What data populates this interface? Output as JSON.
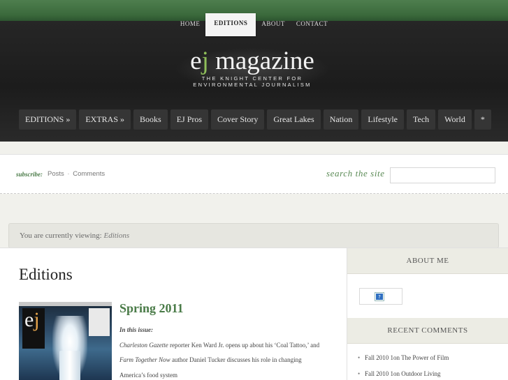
{
  "topnav": {
    "items": [
      {
        "label": "HOME",
        "active": false
      },
      {
        "label": "EDITIONS",
        "active": true
      },
      {
        "label": "ABOUT",
        "active": false
      },
      {
        "label": "CONTACT",
        "active": false
      }
    ]
  },
  "logo": {
    "title_e": "e",
    "title_j": "j",
    "title_rest": " magazine",
    "tagline_1": "THE KNIGHT CENTER FOR",
    "tagline_2": "ENVIRONMENTAL JOURNALISM"
  },
  "mainnav": {
    "items": [
      "EDITIONS »",
      "EXTRAS »",
      "Books",
      "EJ Pros",
      "Cover Story",
      "Great Lakes",
      "Nation",
      "Lifestyle",
      "Tech",
      "World",
      "*"
    ]
  },
  "subscribe": {
    "label": "subscribe:",
    "posts": "Posts",
    "separator": "·",
    "comments": "Comments"
  },
  "search": {
    "label": "search the site",
    "value": ""
  },
  "breadcrumb": {
    "prefix": "You are currently viewing:",
    "current": "Editions"
  },
  "main": {
    "page_title": "Editions",
    "post": {
      "title": "Spring 2011",
      "in_this_issue": "In this issue:",
      "line1_pub": "Charleston Gazette",
      "line1_text": " reporter Ken Ward Jr. opens up about his  ‘Coal Tattoo,’ and",
      "line2_pub": "Farm Together Now",
      "line2_text": " author Daniel Tucker discusses his role in changing",
      "line3_text": "America’s food system"
    }
  },
  "sidebar": {
    "about_heading": "ABOUT ME",
    "recent_heading": "RECENT COMMENTS",
    "recent_comments": [
      "Fall 2010 1on The Power of Film",
      "Fall 2010 1on Outdoor Living"
    ]
  },
  "colors": {
    "accent_green": "#4a7b48",
    "header_dark": "#1c1c1c",
    "top_band": "#3b6a3c"
  }
}
